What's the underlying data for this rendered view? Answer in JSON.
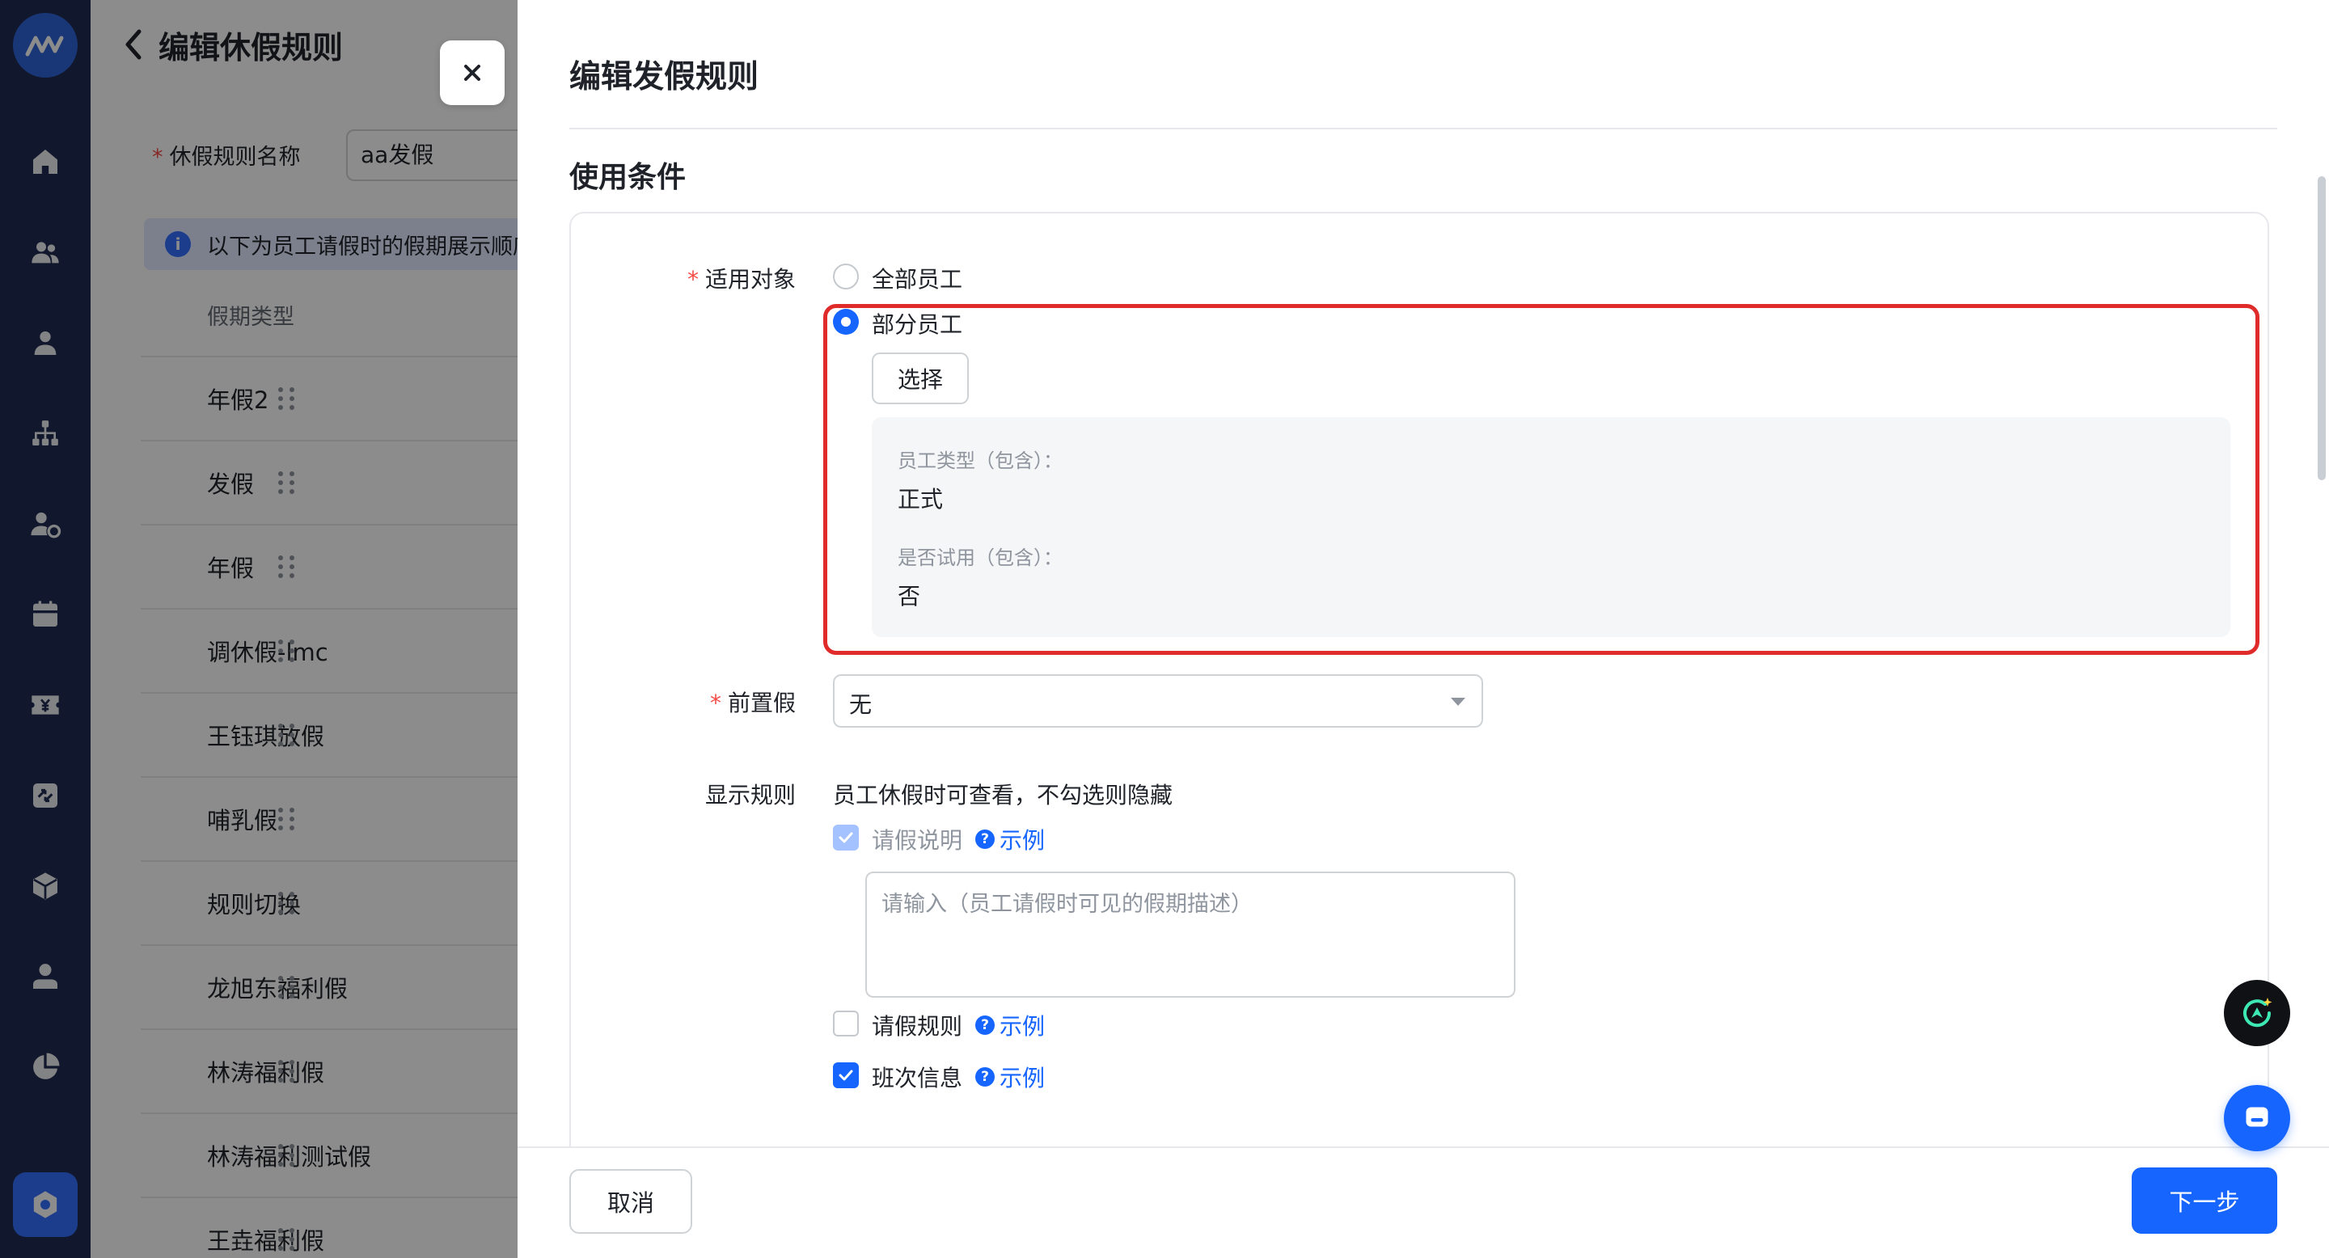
{
  "nav_rail": {
    "icons": [
      "home-icon",
      "team-icon",
      "person-icon",
      "org-chart-icon",
      "employee-settings-icon",
      "calendar-icon",
      "payroll-icon",
      "approval-icon",
      "package-icon",
      "profile-icon",
      "report-icon",
      "settings-icon"
    ]
  },
  "background_page": {
    "title": "编辑休假规则",
    "name_label": "休假规则名称",
    "name_value": "aa发假",
    "notice": "以下为员工请假时的假期展示顺序",
    "column_header": "假期类型",
    "rows": [
      "年假2",
      "发假",
      "年假",
      "调休假-lmc",
      "王钰琪放假",
      "哺乳假",
      "规则切换",
      "龙旭东福利假",
      "林涛福利假",
      "林涛福利测试假",
      "王垚福利假"
    ]
  },
  "drawer": {
    "title": "编辑发假规则",
    "section_title": "使用条件",
    "applicable": {
      "label": "适用对象",
      "option_all": "全部员工",
      "option_partial": "部分员工",
      "selected": "部分员工",
      "select_button": "选择",
      "conditions": [
        {
          "label": "员工类型（包含）：",
          "value": "正式"
        },
        {
          "label": "是否试用（包含）：",
          "value": "否"
        }
      ]
    },
    "prerequisite": {
      "label": "前置假",
      "value": "无"
    },
    "display_rules": {
      "label": "显示规则",
      "hint": "员工休假时可查看，不勾选则隐藏",
      "items": [
        {
          "label": "请假说明",
          "checked": true,
          "disabled": true,
          "example": "示例"
        },
        {
          "label": "请假规则",
          "checked": false,
          "disabled": false,
          "example": "示例"
        },
        {
          "label": "班次信息",
          "checked": true,
          "disabled": false,
          "example": "示例"
        }
      ],
      "description_placeholder": "请输入（员工请假时可见的假期描述）"
    }
  },
  "footer": {
    "cancel": "取消",
    "next": "下一步"
  },
  "colors": {
    "primary": "#1665ff",
    "rail": "#1f2a52",
    "highlight": "#e02b2b",
    "required": "#f54a45"
  }
}
